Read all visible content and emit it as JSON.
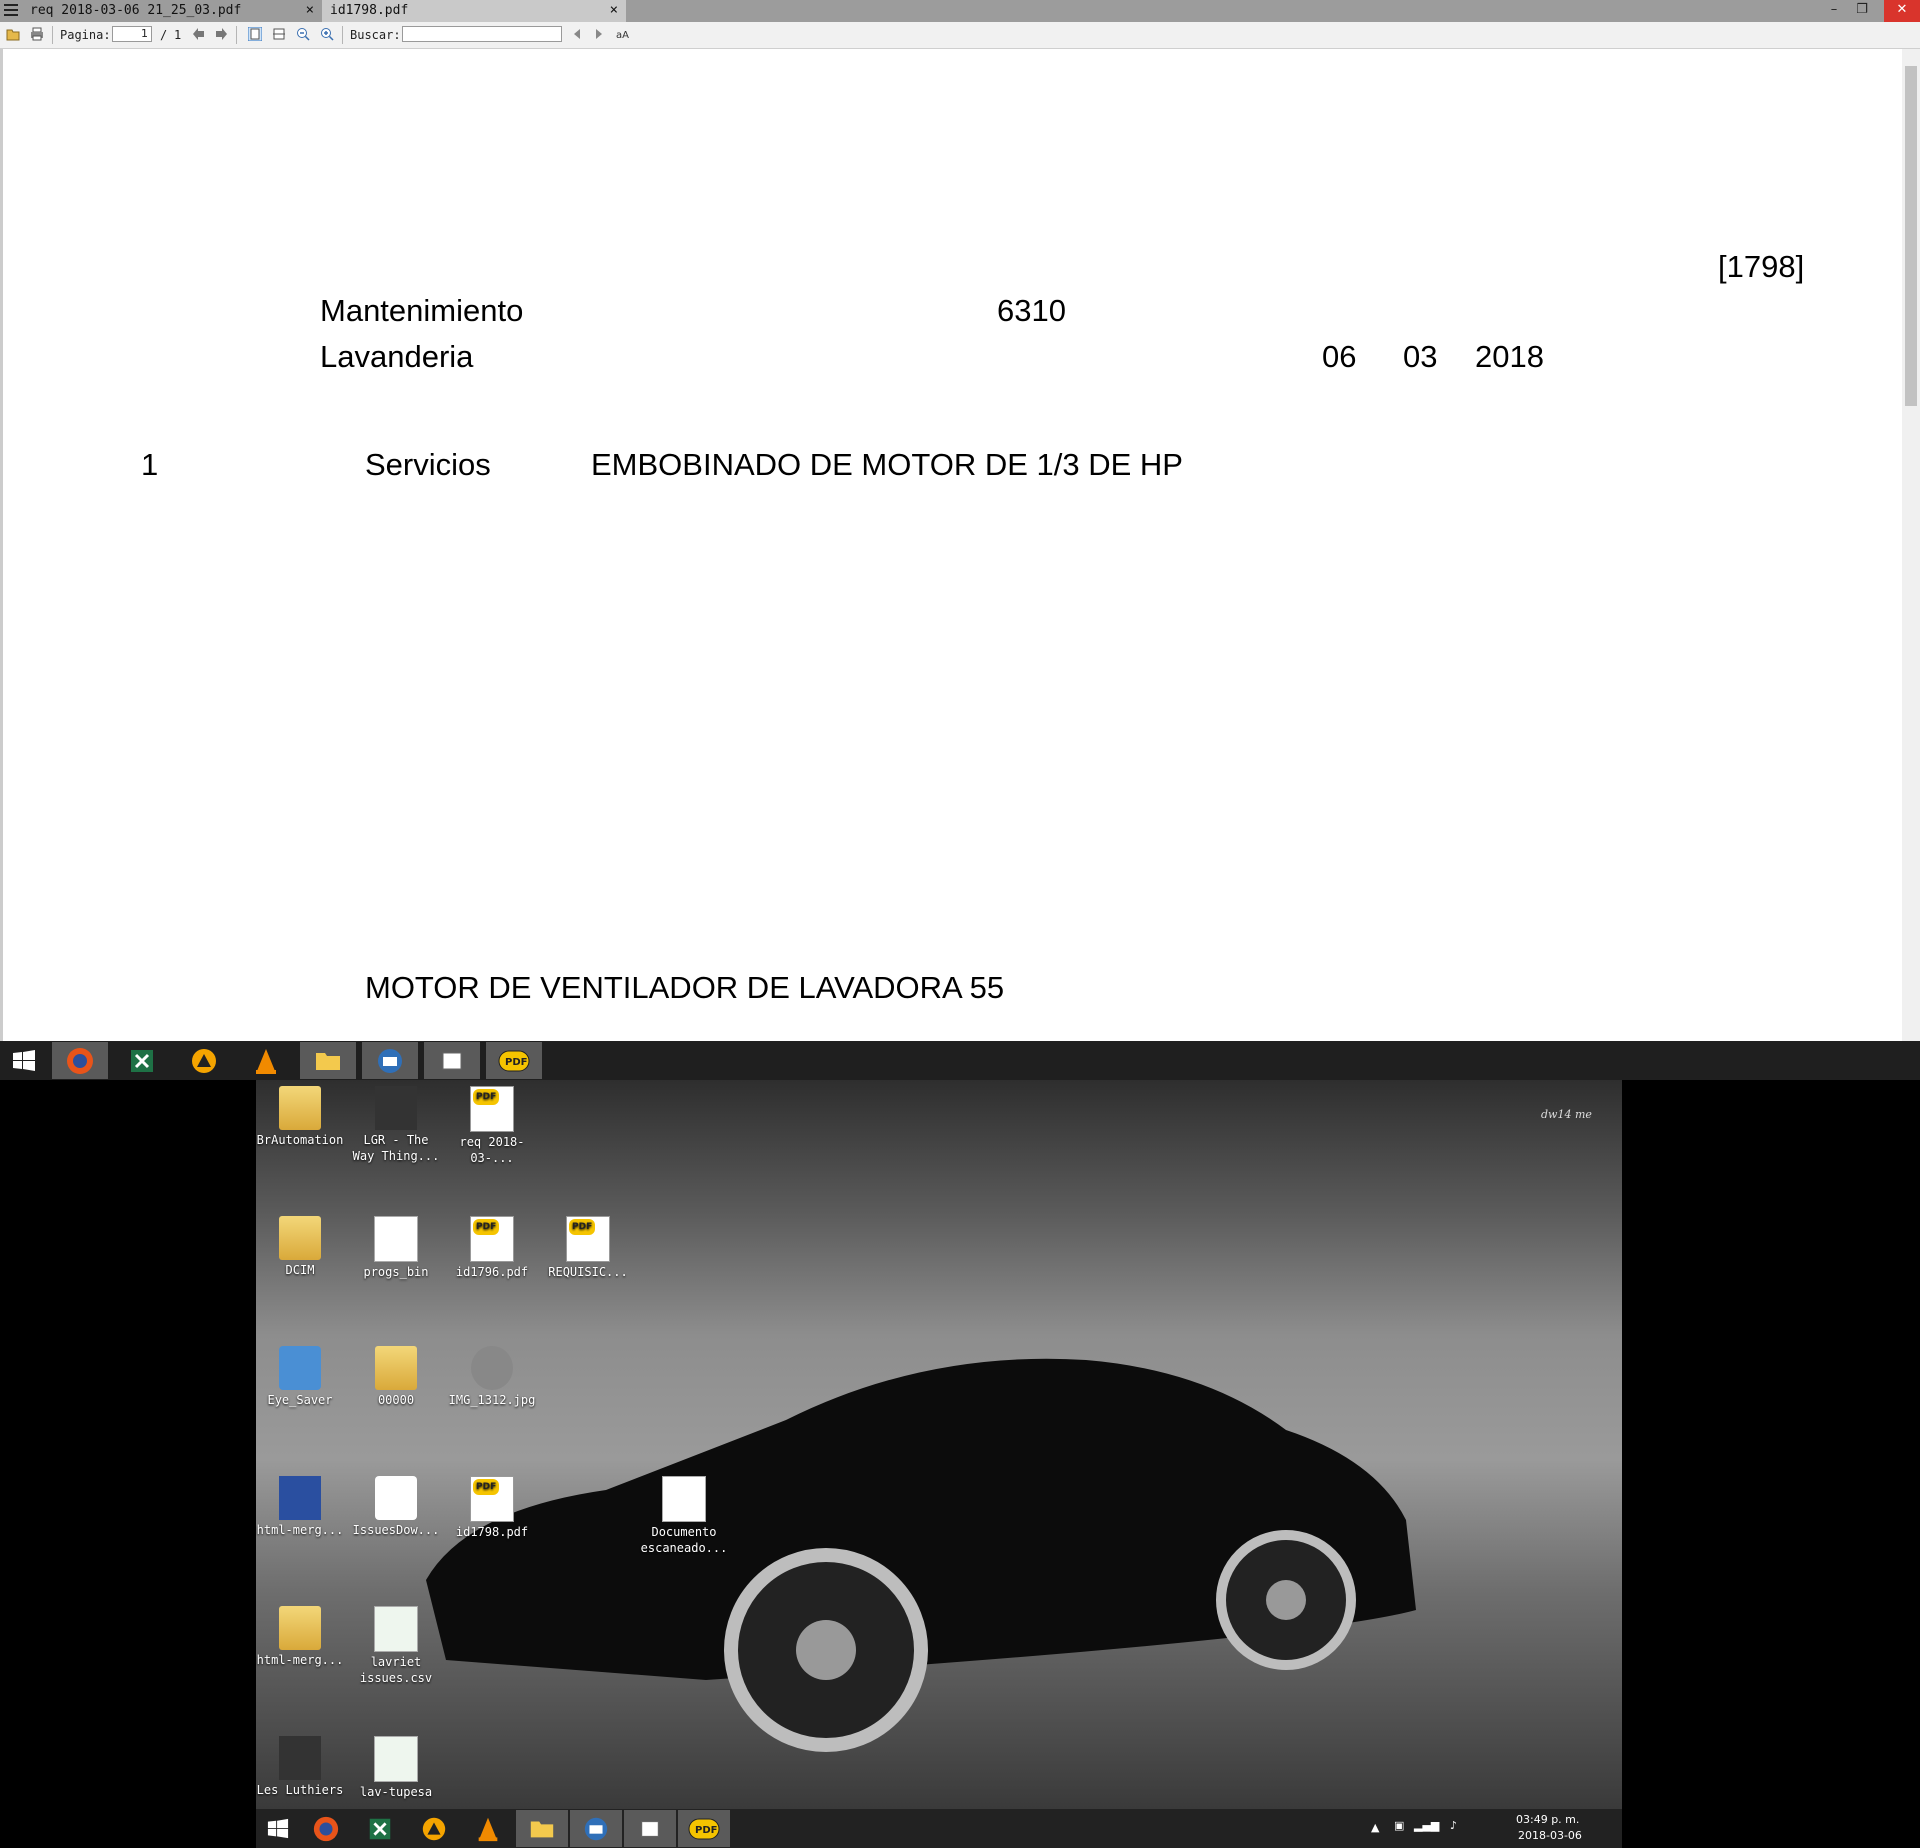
{
  "window": {
    "tabs": [
      {
        "label": "req 2018-03-06 21_25_03.pdf",
        "close": "×"
      },
      {
        "label": "id1798.pdf",
        "close": "×"
      }
    ],
    "controls": {
      "minimize": "–",
      "restore": "❐",
      "close": "✕"
    }
  },
  "toolbar": {
    "page_label": "Pagina:",
    "page_current": "1",
    "page_sep": "/",
    "page_total": "1",
    "search_label": "Buscar:",
    "search_value": ""
  },
  "document": {
    "ref_number": "[1798]",
    "department": "Mantenimiento",
    "code": "6310",
    "area": "Lavanderia",
    "date_day": "06",
    "date_month": "03",
    "date_year": "2018",
    "item_qty": "1",
    "item_type": "Servicios",
    "item_desc": "EMBOBINADO DE MOTOR DE 1/3 DE HP",
    "item_note": "MOTOR DE VENTILADOR DE LAVADORA 55"
  },
  "desktop": {
    "icons": [
      {
        "label": "BrAutomation",
        "type": "folder"
      },
      {
        "label": "LGR - The Way Thing...",
        "type": "video"
      },
      {
        "label": "req 2018-03-...",
        "type": "pdf"
      },
      {
        "label": "DCIM",
        "type": "folder"
      },
      {
        "label": "progs_bin",
        "type": "file"
      },
      {
        "label": "id1796.pdf",
        "type": "pdf"
      },
      {
        "label": "REQUISIC...",
        "type": "pdf"
      },
      {
        "label": "Eye_Saver",
        "type": "app"
      },
      {
        "label": "00000",
        "type": "folder"
      },
      {
        "label": "IMG_1312.jpg",
        "type": "image"
      },
      {
        "label": "html-merg...",
        "type": "app"
      },
      {
        "label": "IssuesDow...",
        "type": "java"
      },
      {
        "label": "id1798.pdf",
        "type": "pdf"
      },
      {
        "label": "Documento escaneado...",
        "type": "document"
      },
      {
        "label": "html-merg...",
        "type": "folder"
      },
      {
        "label": "lavriet issues.csv",
        "type": "csv"
      },
      {
        "label": "Les Luthiers",
        "type": "video"
      },
      {
        "label": "lav-tupesa",
        "type": "csv"
      }
    ],
    "watermark": "dw14 me"
  },
  "tray": {
    "time": "03:49 p. m.",
    "date": "2018-03-06"
  },
  "colors": {
    "titlebar": "#9c9c9c",
    "active_tab": "#c9c9c9",
    "close_button": "#d9342c",
    "taskbar": "#1f1f1f",
    "pdf_badge": "#f5c400"
  }
}
